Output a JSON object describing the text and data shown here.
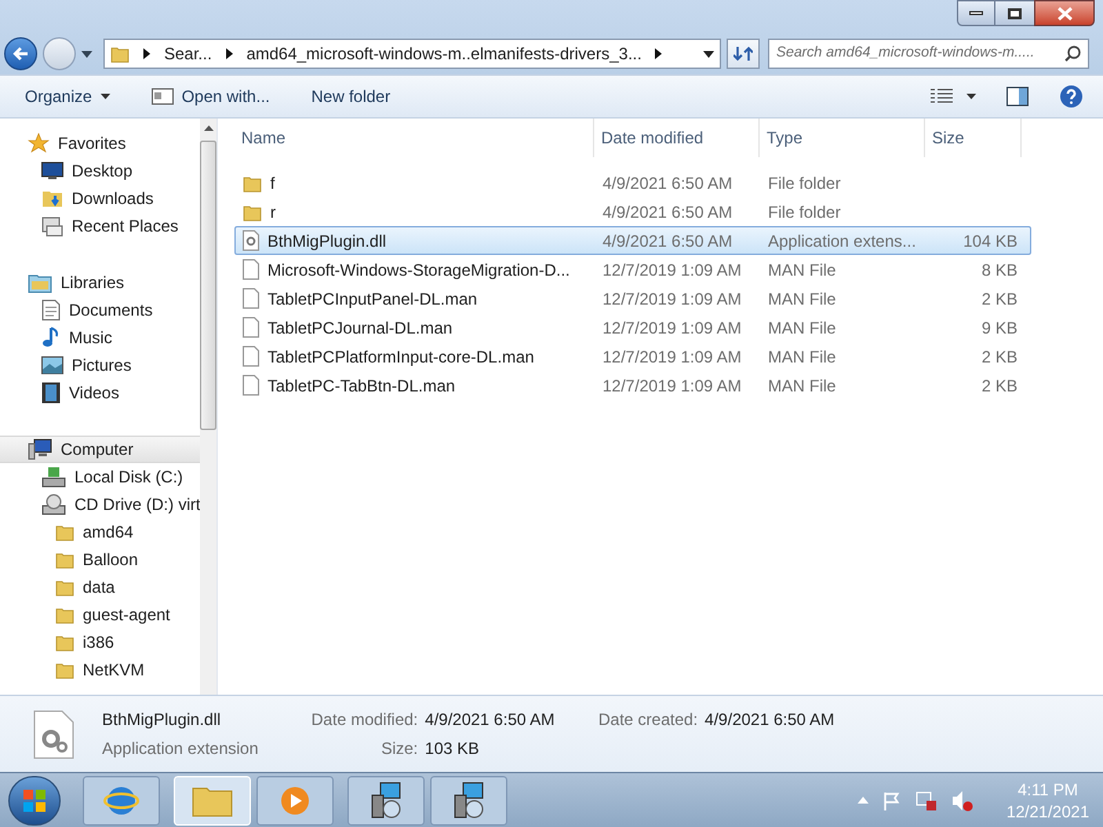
{
  "address_bar": {
    "crumbs": [
      "Sear...",
      "amd64_microsoft-windows-m..elmanifests-drivers_3..."
    ]
  },
  "search": {
    "placeholder": "Search amd64_microsoft-windows-m....."
  },
  "toolbar": {
    "buttons": [
      "Organize",
      "Open with...",
      "New folder"
    ]
  },
  "nav": [
    {
      "label": "Favorites",
      "kind": "favorites",
      "selected": false,
      "children": [
        {
          "label": "Desktop",
          "kind": "desktop",
          "selected": false
        },
        {
          "label": "Downloads",
          "kind": "downloads",
          "selected": false
        },
        {
          "label": "Recent Places",
          "kind": "recent",
          "selected": false
        }
      ]
    },
    {
      "label": "Libraries",
      "kind": "libraries",
      "selected": false,
      "children": [
        {
          "label": "Documents",
          "kind": "documents",
          "selected": false
        },
        {
          "label": "Music",
          "kind": "music",
          "selected": false
        },
        {
          "label": "Pictures",
          "kind": "pictures",
          "selected": false
        },
        {
          "label": "Videos",
          "kind": "videos",
          "selected": false
        }
      ]
    },
    {
      "label": "Computer",
      "kind": "computer",
      "selected": true,
      "children": [
        {
          "label": "Local Disk (C:)",
          "kind": "disk",
          "selected": false
        },
        {
          "label": "CD Drive (D:) virt",
          "kind": "cd",
          "selected": false,
          "children": [
            {
              "label": "amd64",
              "kind": "folder",
              "selected": false
            },
            {
              "label": "Balloon",
              "kind": "folder",
              "selected": false
            },
            {
              "label": "data",
              "kind": "folder",
              "selected": false
            },
            {
              "label": "guest-agent",
              "kind": "folder",
              "selected": false
            },
            {
              "label": "i386",
              "kind": "folder",
              "selected": false
            },
            {
              "label": "NetKVM",
              "kind": "folder",
              "selected": false
            }
          ]
        }
      ]
    }
  ],
  "table": {
    "columns": [
      "Name",
      "Date modified",
      "Type",
      "Size"
    ],
    "rows": [
      {
        "kind": "folder",
        "name": "f",
        "date": "4/9/2021 6:50 AM",
        "type": "File folder",
        "size": "",
        "selected": false
      },
      {
        "kind": "folder",
        "name": "r",
        "date": "4/9/2021 6:50 AM",
        "type": "File folder",
        "size": "",
        "selected": false
      },
      {
        "kind": "dll",
        "name": "BthMigPlugin.dll",
        "date": "4/9/2021 6:50 AM",
        "type": "Application extens...",
        "size": "104 KB",
        "selected": true
      },
      {
        "kind": "file",
        "name": "Microsoft-Windows-StorageMigration-D...",
        "date": "12/7/2019 1:09 AM",
        "type": "MAN File",
        "size": "8 KB",
        "selected": false
      },
      {
        "kind": "file",
        "name": "TabletPCInputPanel-DL.man",
        "date": "12/7/2019 1:09 AM",
        "type": "MAN File",
        "size": "2 KB",
        "selected": false
      },
      {
        "kind": "file",
        "name": "TabletPCJournal-DL.man",
        "date": "12/7/2019 1:09 AM",
        "type": "MAN File",
        "size": "9 KB",
        "selected": false
      },
      {
        "kind": "file",
        "name": "TabletPCPlatformInput-core-DL.man",
        "date": "12/7/2019 1:09 AM",
        "type": "MAN File",
        "size": "2 KB",
        "selected": false
      },
      {
        "kind": "file",
        "name": "TabletPC-TabBtn-DL.man",
        "date": "12/7/2019 1:09 AM",
        "type": "MAN File",
        "size": "2 KB",
        "selected": false
      }
    ]
  },
  "details": {
    "name": "BthMigPlugin.dll",
    "type": "Application extension",
    "fields": [
      {
        "label": "Date modified:",
        "value": "4/9/2021 6:50 AM"
      },
      {
        "label": "Size:",
        "value": "103 KB"
      },
      {
        "label": "Date created:",
        "value": "4/9/2021 6:50 AM"
      }
    ]
  },
  "taskbar": {
    "items": [
      {
        "kind": "ie",
        "selected": false
      },
      {
        "kind": "explorer",
        "selected": true
      },
      {
        "kind": "media",
        "selected": false
      },
      {
        "kind": "installer",
        "selected": false
      },
      {
        "kind": "installer",
        "selected": false
      }
    ],
    "time": "4:11 PM",
    "date": "12/21/2021"
  }
}
